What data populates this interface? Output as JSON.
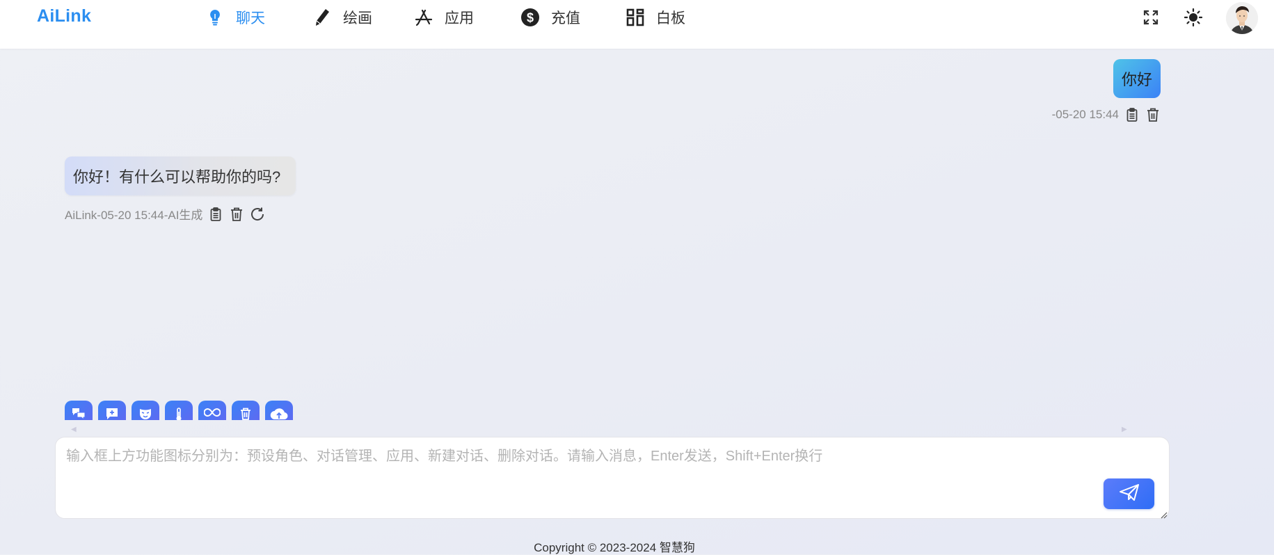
{
  "app": {
    "logo": "AiLink"
  },
  "nav": {
    "items": [
      {
        "label": "聊天",
        "icon": "lightbulb-icon",
        "active": true
      },
      {
        "label": "绘画",
        "icon": "pencil-icon",
        "active": false
      },
      {
        "label": "应用",
        "icon": "app-store-icon",
        "active": false
      },
      {
        "label": "充值",
        "icon": "dollar-icon",
        "active": false
      },
      {
        "label": "白板",
        "icon": "grid-icon",
        "active": false
      }
    ]
  },
  "header_actions": {
    "fullscreen_icon": "fullscreen-icon",
    "theme_icon": "sun-icon",
    "avatar": "user-avatar"
  },
  "messages": [
    {
      "role": "user",
      "text": "你好",
      "meta": "-05-20 15:44",
      "actions": [
        "copy-icon",
        "delete-icon"
      ]
    },
    {
      "role": "assistant",
      "text": "你好！有什么可以帮助你的吗?",
      "meta": "AiLink-05-20 15:44-AI生成",
      "actions": [
        "copy-icon",
        "delete-icon",
        "regenerate-icon"
      ]
    }
  ],
  "tools": [
    "preset-role-icon",
    "conversation-manage-icon",
    "mask-icon",
    "temperature-icon",
    "infinity-icon",
    "delete-conversation-icon",
    "cloud-upload-icon"
  ],
  "composer": {
    "placeholder": "输入框上方功能图标分别为：预设角色、对话管理、应用、新建对话、删除对话。请输入消息，Enter发送，Shift+Enter换行",
    "value": "",
    "send_icon": "send-icon"
  },
  "footer": {
    "text": "Copyright © 2023-2024 智慧狗"
  },
  "colors": {
    "accent": "#2b8ef0",
    "send_button": "#3b6ff6"
  }
}
